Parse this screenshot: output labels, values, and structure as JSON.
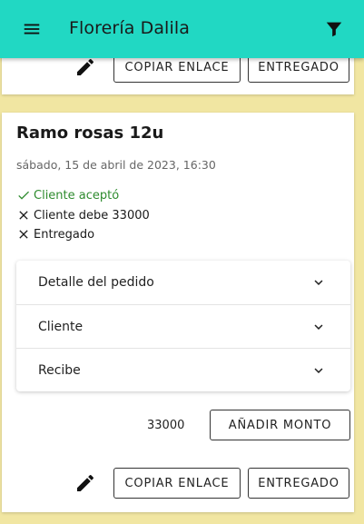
{
  "app_bar": {
    "title": "Florería Dalila",
    "menu_icon": "menu-icon",
    "filter_icon": "filter-icon",
    "color": "#21d8c3"
  },
  "previous_card": {
    "edit_icon": "pencil-icon",
    "copy_link_label": "COPIAR ENLACE",
    "delivered_label": "ENTREGADO"
  },
  "order": {
    "title": "Ramo rosas 12u",
    "date": "sábado, 15 de abril de 2023, 16:30",
    "statuses": [
      {
        "icon": "check-icon",
        "text": "Cliente aceptó",
        "color": "#2e8b2e"
      },
      {
        "icon": "close-icon",
        "text": "Cliente debe 33000",
        "color": "#1a1a1a"
      },
      {
        "icon": "close-icon",
        "text": "Entregado",
        "color": "#1a1a1a"
      }
    ],
    "accordion": [
      {
        "label": "Detalle del pedido",
        "icon": "chevron-down-icon"
      },
      {
        "label": "Cliente",
        "icon": "chevron-down-icon"
      },
      {
        "label": "Recibe",
        "icon": "chevron-down-icon"
      }
    ],
    "amount": "33000",
    "add_amount_label": "AÑADIR MONTO",
    "edit_icon": "pencil-icon",
    "copy_link_label": "COPIAR ENLACE",
    "delivered_label": "ENTREGADO"
  },
  "background_color": "#f1e6a2"
}
